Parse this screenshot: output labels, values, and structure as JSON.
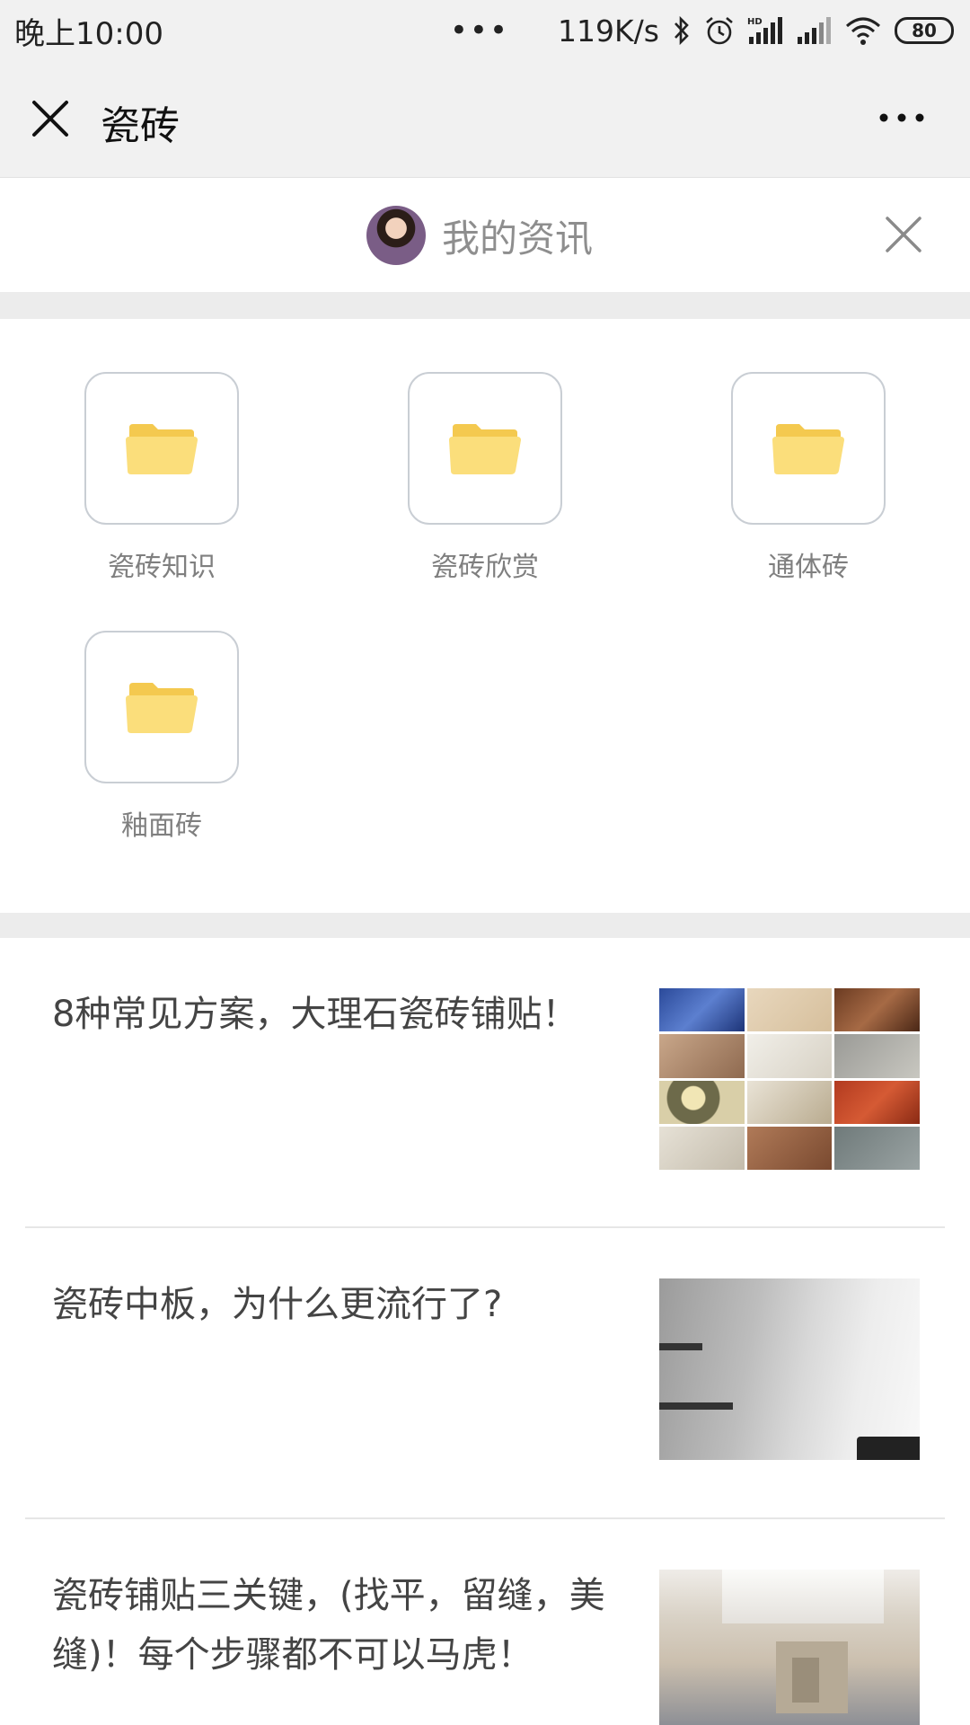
{
  "status_bar": {
    "time": "晚上10:00",
    "dots": "•••",
    "network_speed": "119K/s",
    "battery": "80"
  },
  "nav": {
    "title": "瓷砖"
  },
  "profile": {
    "name": "我的资讯"
  },
  "folders": [
    {
      "label": "瓷砖知识"
    },
    {
      "label": "瓷砖欣赏"
    },
    {
      "label": "通体砖"
    },
    {
      "label": "釉面砖"
    }
  ],
  "articles": [
    {
      "title": "8种常见方案，大理石瓷砖铺贴！"
    },
    {
      "title": "瓷砖中板，为什么更流行了?"
    },
    {
      "title": "瓷砖铺贴三关键，(找平，留缝，美缝)！每个步骤都不可以马虎！"
    }
  ],
  "colors": {
    "folder_yellow": "#f8dc74",
    "background_gray": "#f1f1f1"
  }
}
